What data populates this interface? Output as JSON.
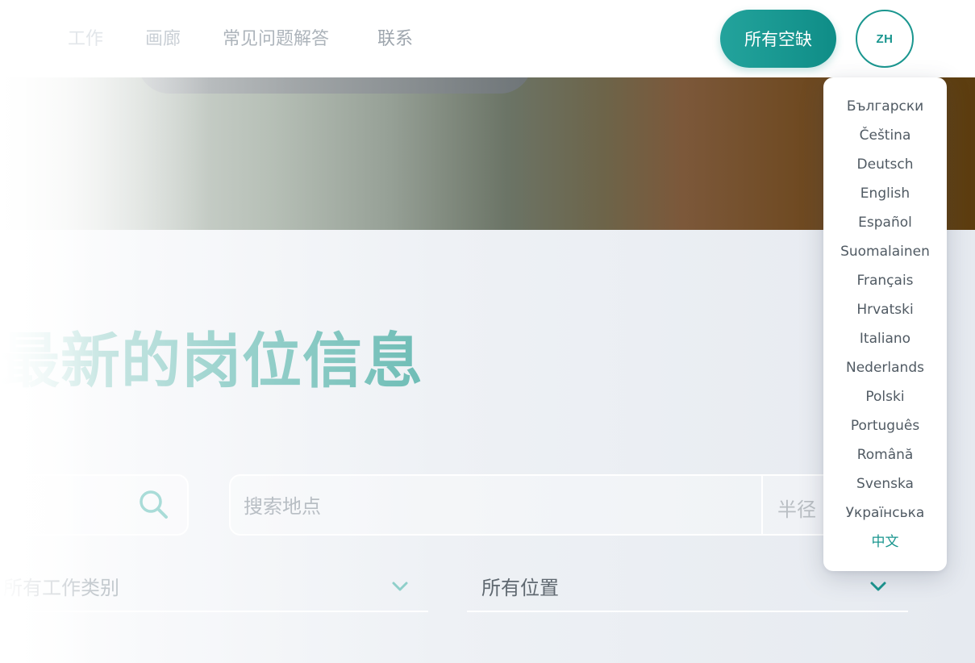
{
  "header": {
    "nav": {
      "jobs": "工作",
      "gallery": "画廊",
      "faq": "常见问题解答",
      "contact": "联系"
    },
    "vacancies_button": "所有空缺",
    "language_button": "ZH"
  },
  "main": {
    "title": "最新的岗位信息",
    "location_search": {
      "placeholder": "搜索地点",
      "radius_label": "半径"
    },
    "filters": {
      "categories": "所有工作类别",
      "locations": "所有位置"
    }
  },
  "language_menu": {
    "items": [
      "Български",
      "Čeština",
      "Deutsch",
      "English",
      "Español",
      "Suomalainen",
      "Français",
      "Hrvatski",
      "Italiano",
      "Nederlands",
      "Polski",
      "Português",
      "Română",
      "Svenska",
      "Українська",
      "中文"
    ],
    "selected": "中文"
  },
  "colors": {
    "accent": "#1a968f",
    "accent_button": "#23a39c",
    "text_muted": "#9aa3ab"
  },
  "icons": {
    "search": "search-icon",
    "chevron": "chevron-down-icon"
  }
}
